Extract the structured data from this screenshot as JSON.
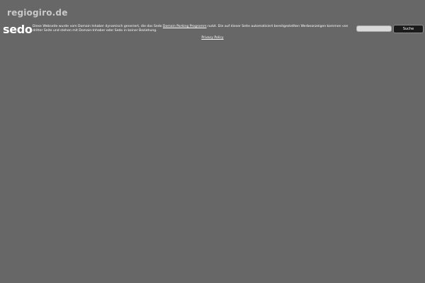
{
  "header": {
    "domain": "regiogiro.de",
    "logo": "sedo"
  },
  "disclaimer": {
    "text_before": "Diese Webseite wurde vom Domain Inhaber dynamisch generiert, die das Sedo ",
    "link_label": "Domain Parking Programm",
    "text_after": " nutzt. Die auf dieser Seite automatisiert bereitgestellten Werbeanzeigen kommen von dritter Seite und stehen mit Domain-Inhaber oder Sedo in keiner Beziehung."
  },
  "search": {
    "input_value": "",
    "button_label": "Suche"
  },
  "footer": {
    "privacy_label": "Privacy Policy"
  },
  "colors": {
    "background": "#676767",
    "text": "#ffffff",
    "button": "#1a1a1a"
  }
}
